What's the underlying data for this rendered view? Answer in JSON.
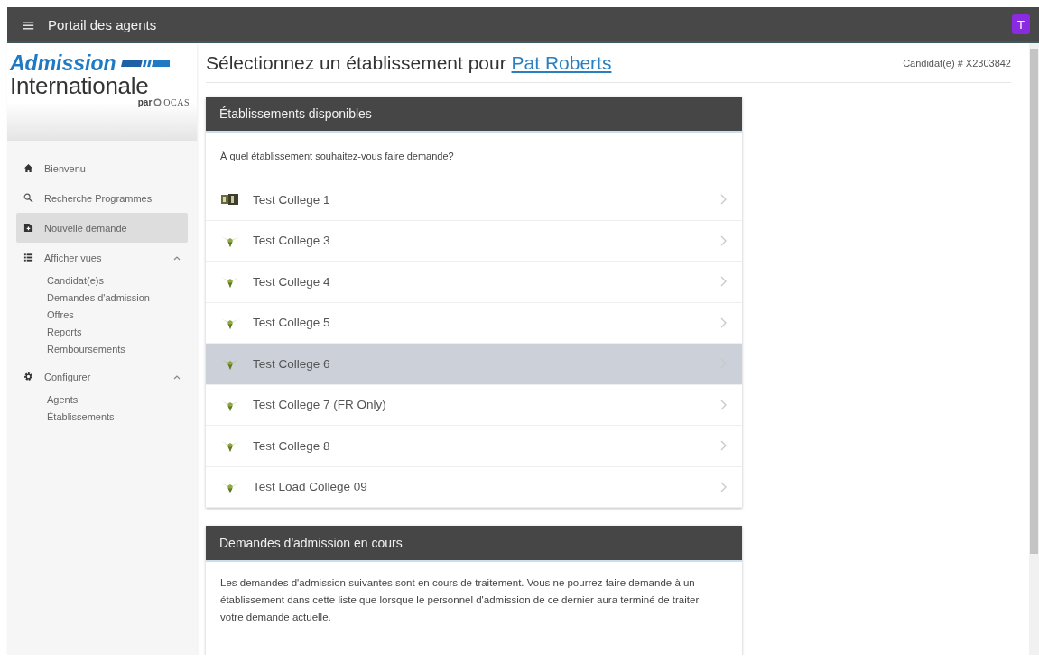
{
  "topbar": {
    "menu_glyph": "≡",
    "title": "Portail des agents",
    "avatar": "T"
  },
  "logo": {
    "line1": "Admission",
    "line2": "Internationale",
    "by": "par",
    "brand": "OCAS"
  },
  "sidebar": {
    "items": [
      {
        "label": "Bienvenu",
        "selected": false
      },
      {
        "label": "Recherche Programmes",
        "selected": false
      },
      {
        "label": "Nouvelle demande",
        "selected": true
      },
      {
        "label": "Afficher vues",
        "selected": false,
        "expanded": true,
        "children": [
          {
            "label": "Candidat(e)s"
          },
          {
            "label": "Demandes d'admission"
          },
          {
            "label": "Offres"
          },
          {
            "label": "Reports"
          },
          {
            "label": "Remboursements"
          }
        ]
      },
      {
        "label": "Configurer",
        "selected": false,
        "expanded": true,
        "children": [
          {
            "label": "Agents"
          },
          {
            "label": "Établissements"
          }
        ]
      }
    ]
  },
  "page": {
    "title": "Sélectionnez un établissement pour ",
    "title_link": "Pat Roberts",
    "candidate": "Candidat(e) # X2303842"
  },
  "available": {
    "title": "Établissements disponibles",
    "question": "À quel établissement souhaitez-vous faire demande?",
    "rows": [
      {
        "kind": "monogram",
        "name": "Test College 1",
        "selected": false
      },
      {
        "kind": "bird",
        "name": "Test College 3",
        "selected": false
      },
      {
        "kind": "bird",
        "name": "Test College 4",
        "selected": false
      },
      {
        "kind": "bird",
        "name": "Test College 5",
        "selected": false
      },
      {
        "kind": "bird",
        "name": "Test College 6",
        "selected": true
      },
      {
        "kind": "bird",
        "name": "Test College 7 (FR Only)",
        "selected": false
      },
      {
        "kind": "bird",
        "name": "Test College 8",
        "selected": false
      },
      {
        "kind": "bird",
        "name": "Test Load College 09",
        "selected": false
      }
    ]
  },
  "in_progress": {
    "title": "Demandes d'admission en cours",
    "text": "Les demandes d'admission suivantes sont en cours de traitement. Vous ne pourrez faire demande à un établissement dans cette liste que lorsque le personnel d'admission de ce dernier aura terminé de traiter votre demande actuelle."
  }
}
